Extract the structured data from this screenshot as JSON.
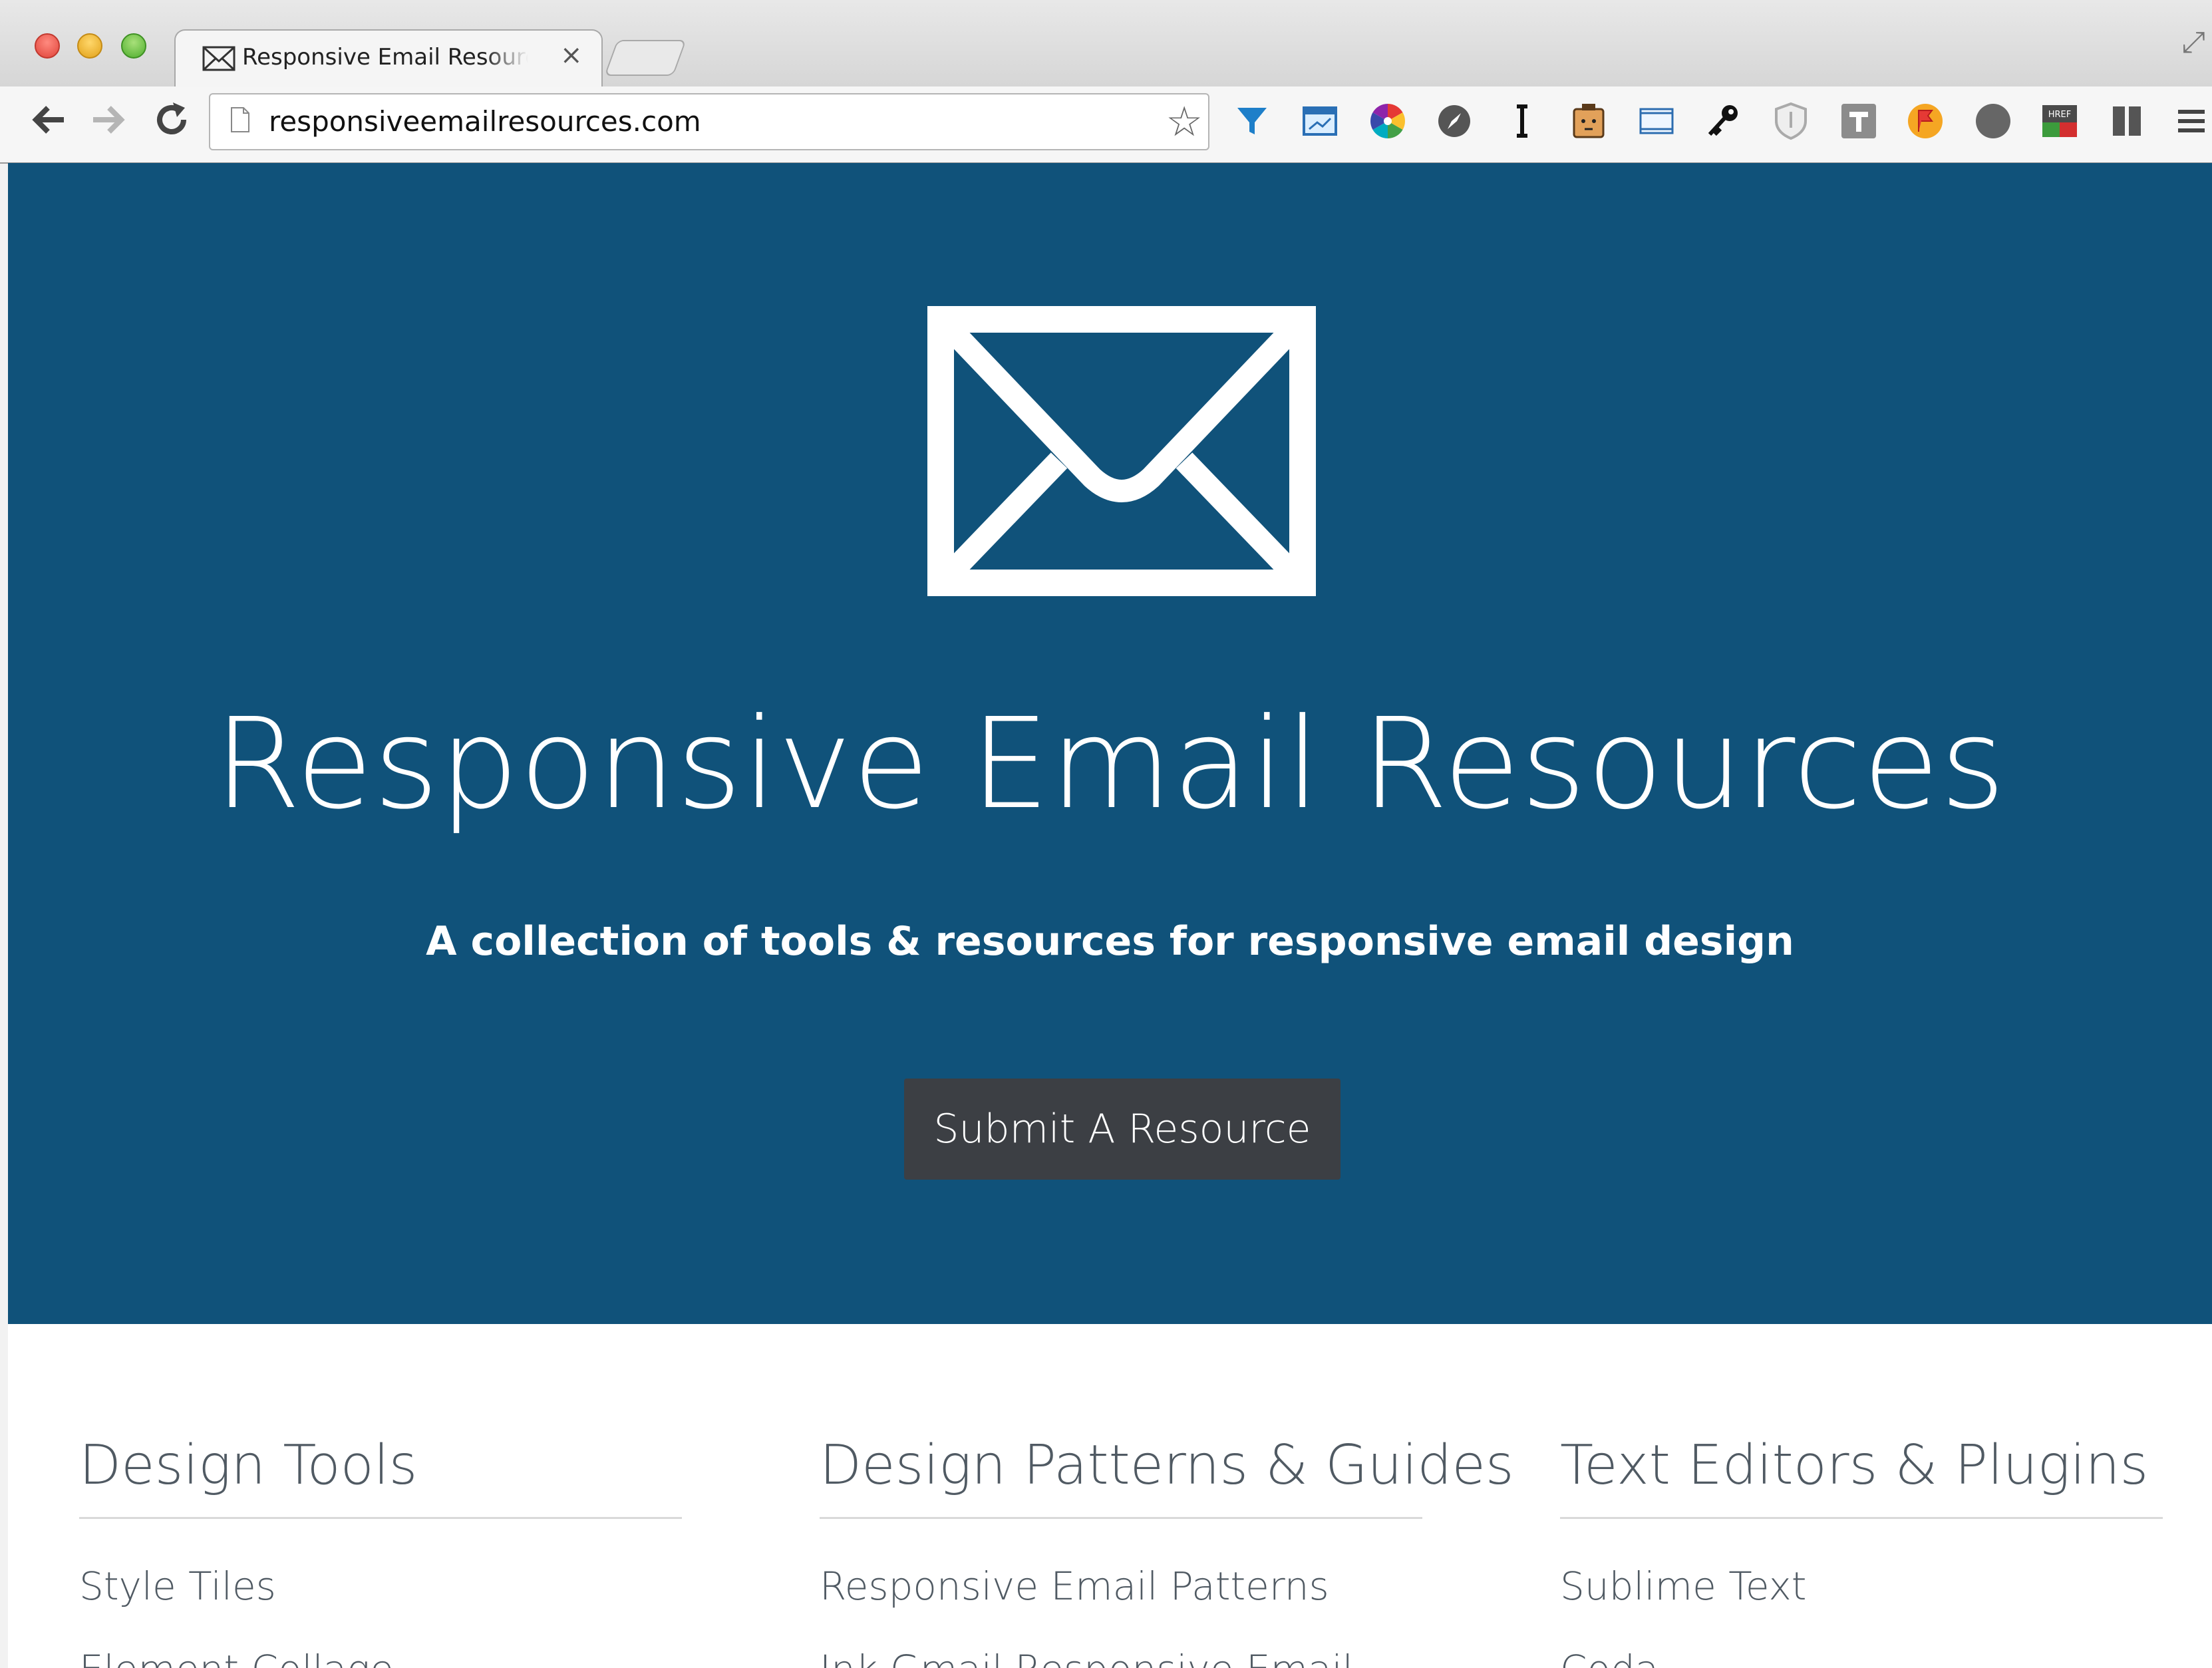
{
  "browser": {
    "tab": {
      "title": "Responsive Email Resources",
      "close_glyph": "×",
      "favicon": "envelope-icon"
    },
    "nav": {
      "back_glyph": "🡐",
      "forward_glyph": "🡒",
      "reload_glyph": "↻"
    },
    "address": {
      "url": "responsiveemailresources.com",
      "bookmark_glyph": "☆"
    },
    "extensions": [
      "funnel-icon",
      "window-icon",
      "color-wheel-icon",
      "compass-icon",
      "cursor-icon",
      "face-icon",
      "screen-icon",
      "key-icon",
      "shield-icon",
      "text-t-icon",
      "flag-icon",
      "circle-icon",
      "href-icon",
      "columns-icon",
      "menu-icon"
    ],
    "fullscreen_glyph": "⤢"
  },
  "hero": {
    "icon": "envelope-icon",
    "title": "Responsive Email Resources",
    "subtitle": "A collection of tools & resources for responsive email design",
    "button_label": "Submit A Resource",
    "background": "#10527a",
    "button_color": "#3c3f44"
  },
  "columns": [
    {
      "heading": "Design Tools",
      "items": [
        "Style Tiles",
        "Element Collage"
      ]
    },
    {
      "heading": "Design Patterns & Guides",
      "items": [
        "Responsive Email Patterns",
        "Ink Gmail Responsive Email"
      ]
    },
    {
      "heading": "Text Editors & Plugins",
      "items": [
        "Sublime Text",
        "Coda"
      ]
    }
  ]
}
